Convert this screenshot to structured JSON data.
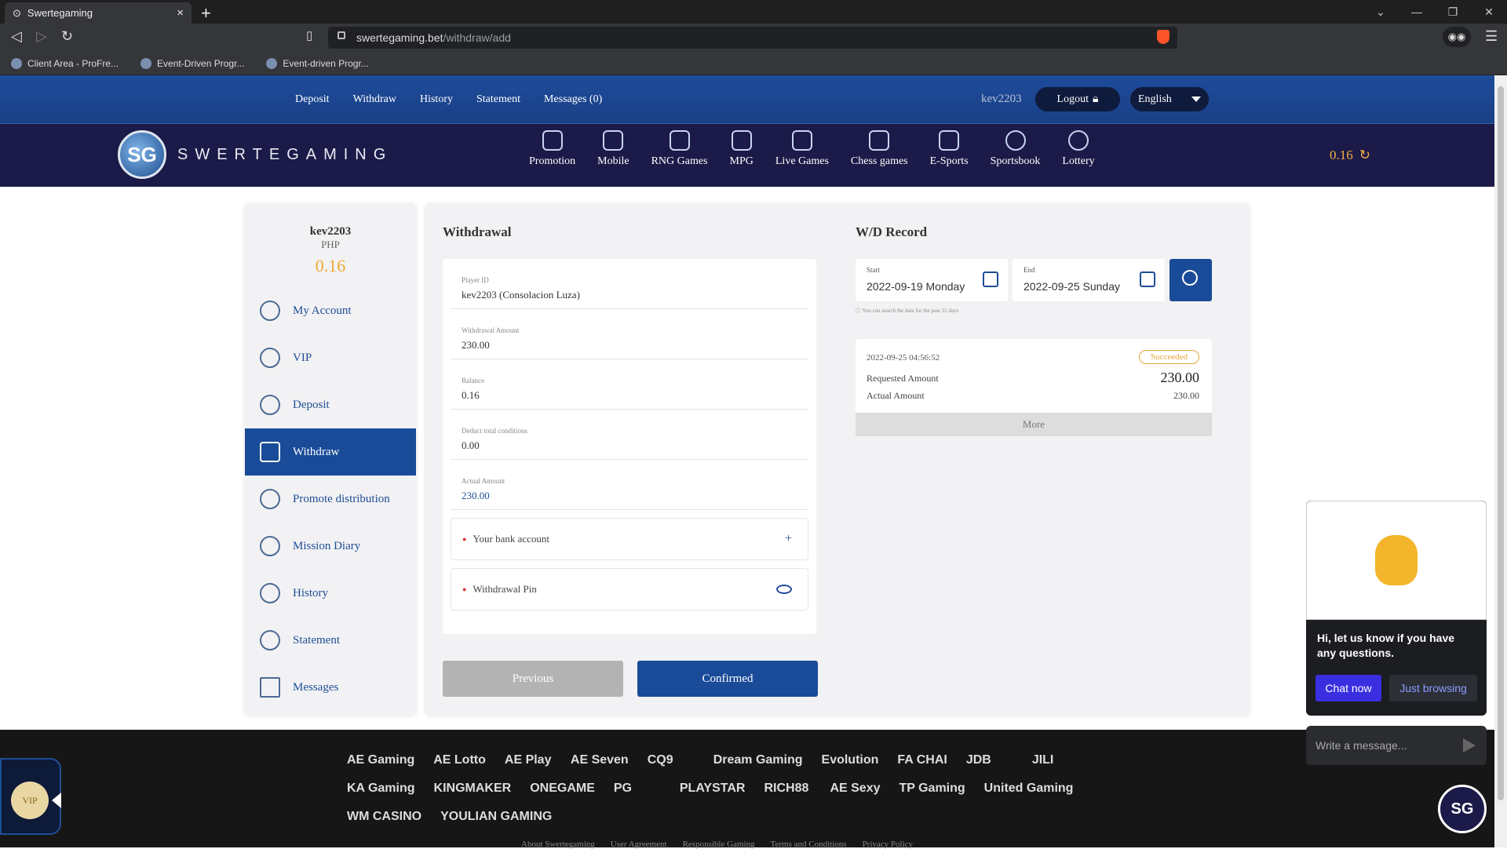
{
  "browser": {
    "tab_title": "Swertegaming",
    "url_host": "swertegaming.bet",
    "url_path": "/withdraw/add",
    "bookmarks": [
      "Client Area - ProFre...",
      "Event-Driven Progr...",
      "Event-driven Progr..."
    ]
  },
  "topnav": {
    "links": [
      "Deposit",
      "Withdraw",
      "History",
      "Statement",
      "Messages (0)"
    ],
    "username": "kev2203",
    "logout": "Logout",
    "language": "English"
  },
  "header": {
    "brand": "SWERTEGAMING",
    "games": [
      "Promotion",
      "Mobile",
      "RNG Games",
      "MPG",
      "Live Games",
      "Chess games",
      "E-Sports",
      "Sportsbook",
      "Lottery"
    ],
    "balance": "0.16"
  },
  "sidebar": {
    "username": "kev2203",
    "currency": "PHP",
    "balance": "0.16",
    "items": [
      "My Account",
      "VIP",
      "Deposit",
      "Withdraw",
      "Promote distribution",
      "Mission Diary",
      "History",
      "Statement",
      "Messages"
    ],
    "active": "Withdraw"
  },
  "withdrawal": {
    "title": "Withdrawal",
    "player_id_label": "Player ID",
    "player_id": "kev2203 (Consolacion Luza)",
    "amount_label": "Withdrawal Amount",
    "amount": "230.00",
    "balance_label": "Balance",
    "balance": "0.16",
    "deduct_label": "Deduct total conditions",
    "deduct": "0.00",
    "actual_label": "Actual Amount",
    "actual": "230.00",
    "bank_label": "Your bank account",
    "pin_label": "Withdrawal Pin",
    "prev_btn": "Previous",
    "confirm_btn": "Confirmed"
  },
  "record": {
    "title": "W/D Record",
    "start_label": "Start",
    "start": "2022-09-19 Monday",
    "end_label": "End",
    "end": "2022-09-25 Sunday",
    "hint": "You can search the data for the past 31 days",
    "entry": {
      "datetime": "2022-09-25 04:56:52",
      "status": "Succeeded",
      "req_label": "Requested Amount",
      "req": "230.00",
      "act_label": "Actual Amount",
      "act": "230.00"
    },
    "more": "More"
  },
  "chat": {
    "message": "Hi, let us know if you have any questions.",
    "chat_now": "Chat now",
    "browsing": "Just browsing",
    "placeholder": "Write a message..."
  },
  "footer": {
    "brands": [
      "AE Gaming",
      "AE Lotto",
      "AE Play",
      "AE Seven",
      "CQ9",
      "Dream Gaming",
      "Evolution",
      "FA CHAI",
      "JDB",
      "JILI",
      "KA Gaming",
      "KINGMAKER",
      "ONEGAME",
      "PG",
      "PLAYSTAR",
      "RICH88",
      "AE Sexy",
      "TP Gaming",
      "United Gaming",
      "WM CASINO",
      "YOULIAN GAMING"
    ],
    "links": [
      "About Swertegaming",
      "User Agreement",
      "Responsible Gaming",
      "Terms and Conditions",
      "Privacy Policy"
    ],
    "vip": "VIP"
  },
  "colors": {
    "primary": "#194b98",
    "header_bg": "#1b1a48",
    "accent": "#f0a733"
  }
}
